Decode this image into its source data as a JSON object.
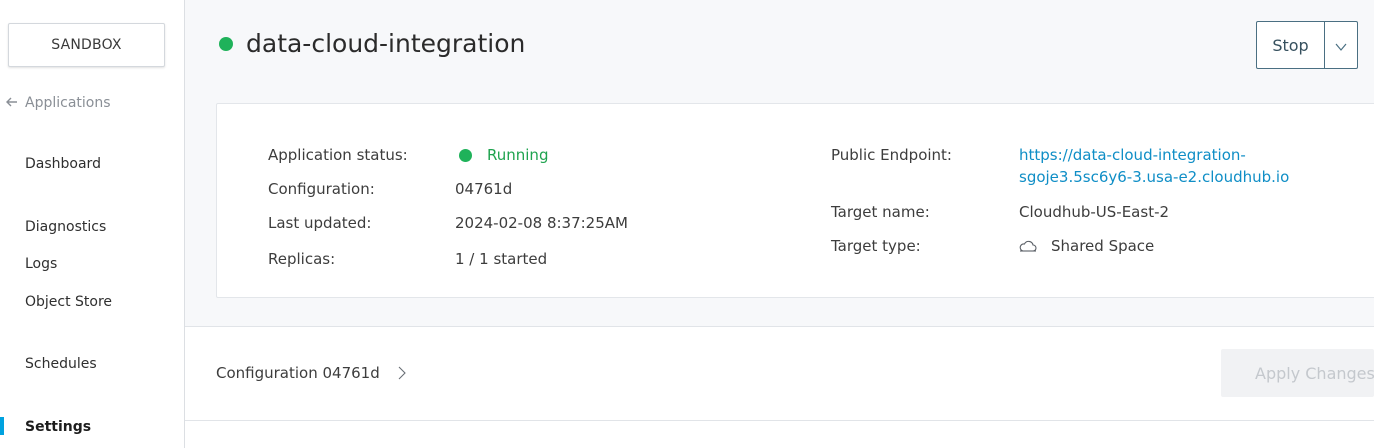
{
  "sidebar": {
    "environment": "SANDBOX",
    "back_label": "Applications",
    "items": [
      {
        "label": "Dashboard"
      },
      {
        "label": "Diagnostics"
      },
      {
        "label": "Logs"
      },
      {
        "label": "Object Store"
      },
      {
        "label": "Schedules"
      },
      {
        "label": "Settings",
        "active": true
      }
    ]
  },
  "header": {
    "app_name": "data-cloud-integration",
    "stop_label": "Stop"
  },
  "details": {
    "status_label": "Application status:",
    "status_value": "Running",
    "configuration_label": "Configuration:",
    "configuration_value": "04761d",
    "last_updated_label": "Last updated:",
    "last_updated_value": "2024-02-08 8:37:25AM",
    "replicas_label": "Replicas:",
    "replicas_value": "1 / 1 started",
    "endpoint_label": "Public Endpoint:",
    "endpoint_line1": "https://data-cloud-integration-",
    "endpoint_line2": "sgoje3.5sc6y6-3.usa-e2.cloudhub.io",
    "target_name_label": "Target name:",
    "target_name_value": "Cloudhub-US-East-2",
    "target_type_label": "Target type:",
    "target_type_value": "Shared Space"
  },
  "config_bar": {
    "config_link": "Configuration 04761d",
    "apply_label": "Apply Changes"
  },
  "colors": {
    "status_green": "#1fb25a",
    "link_blue": "#0f8ec6",
    "active_indicator": "#00a2df"
  },
  "icons": {
    "back": "arrow-left-icon",
    "stop_menu": "chevron-down-icon",
    "target_type": "cloud-icon",
    "config_link": "chevron-right-icon"
  }
}
